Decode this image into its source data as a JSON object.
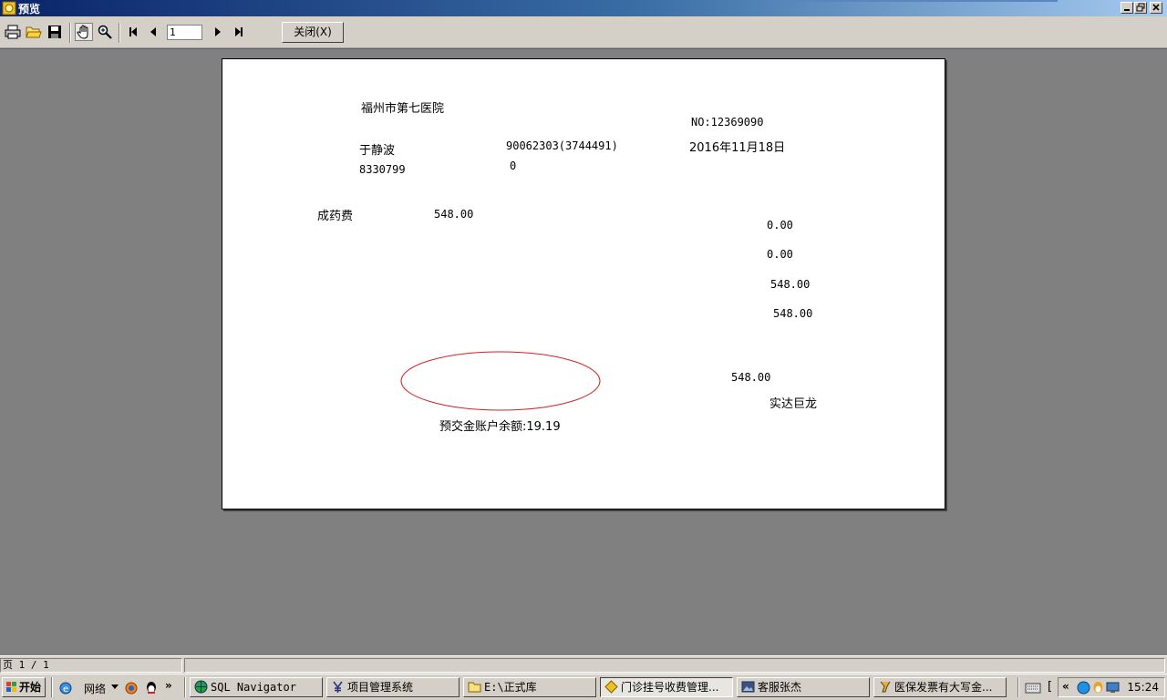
{
  "window": {
    "title": "预览"
  },
  "toolbar": {
    "page_value": "1",
    "close_label": "关闭(X)"
  },
  "receipt": {
    "hospital": "福州市第七医院",
    "number": "NO:12369090",
    "patient_name": "于静波",
    "patient_id": "90062303(3744491)",
    "date": "2016年11月18日",
    "code": "8330799",
    "zero_value": "0",
    "item_name": "成药费",
    "item_amount": "548.00",
    "right_values": [
      "0.00",
      "0.00",
      "548.00",
      "548.00"
    ],
    "total": "548.00",
    "operator": "实达巨龙",
    "balance": "预交金账户余额:19.19"
  },
  "status": {
    "page_indicator": "页 1 / 1"
  },
  "taskbar": {
    "start_label": "开始",
    "network_label": "网络",
    "more_label": "»",
    "tasks": [
      "SQL Navigator",
      "项目管理系统",
      "E:\\正式库",
      "门诊挂号收费管理...",
      "客服张杰",
      "医保发票有大写金..."
    ],
    "tray_chevron": "«",
    "clock": "15:24"
  },
  "colors": {
    "title_start": "#0a246a",
    "title_end": "#a6caf0",
    "ellipse": "#d62020"
  }
}
